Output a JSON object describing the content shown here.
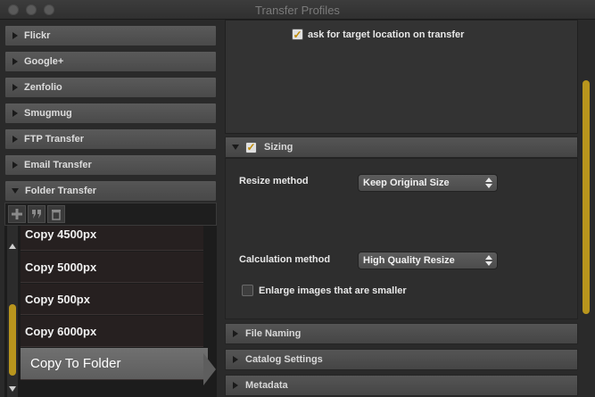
{
  "window": {
    "title": "Transfer Profiles"
  },
  "services": [
    {
      "label": "Flickr"
    },
    {
      "label": "Google+"
    },
    {
      "label": "Zenfolio"
    },
    {
      "label": "Smugmug"
    },
    {
      "label": "FTP Transfer"
    },
    {
      "label": "Email Transfer"
    },
    {
      "label": "Folder Transfer"
    }
  ],
  "toolbar": {
    "add_icon": "plus-icon",
    "duplicate_icon": "quote-icon",
    "delete_icon": "trash-icon"
  },
  "presets": [
    {
      "label": "Copy 4500px"
    },
    {
      "label": "Copy 5000px"
    },
    {
      "label": "Copy 500px"
    },
    {
      "label": "Copy 6000px"
    }
  ],
  "selected_preset": {
    "label": "Copy To Folder"
  },
  "top_section": {
    "ask_target_label": "ask for target location on transfer",
    "ask_target_checked": true
  },
  "sizing": {
    "header": "Sizing",
    "enabled": true,
    "resize_method_label": "Resize method",
    "resize_method_value": "Keep Original Size",
    "calc_method_label": "Calculation method",
    "calc_method_value": "High Quality Resize",
    "enlarge_label": "Enlarge images that are smaller",
    "enlarge_checked": false
  },
  "sections": [
    {
      "label": "File Naming"
    },
    {
      "label": "Catalog Settings"
    },
    {
      "label": "Metadata"
    }
  ],
  "colors": {
    "accent": "#b8951d",
    "check": "#c08a00"
  }
}
